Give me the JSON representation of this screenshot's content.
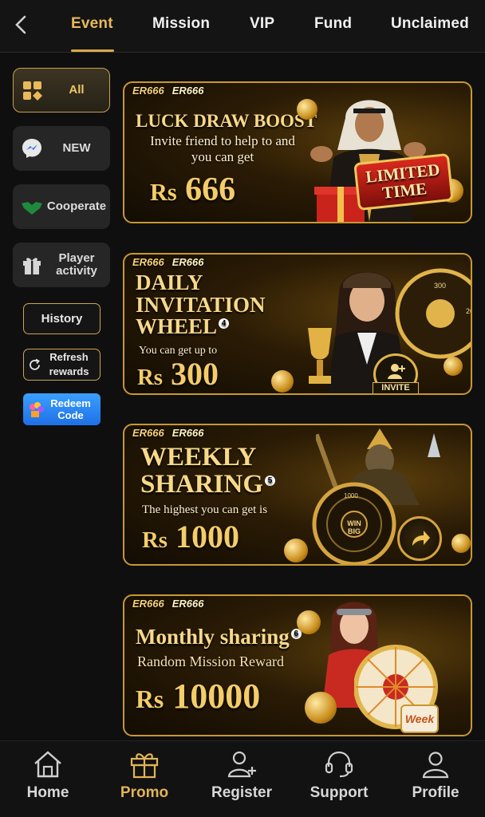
{
  "tabs": [
    {
      "label": "Event",
      "active": true
    },
    {
      "label": "Mission"
    },
    {
      "label": "VIP"
    },
    {
      "label": "Fund"
    },
    {
      "label": "Unclaimed"
    }
  ],
  "sidebar": {
    "items": [
      {
        "label": "All",
        "icon": "grid-icon",
        "active": true
      },
      {
        "label": "NEW",
        "icon": "messenger-icon"
      },
      {
        "label": "Cooperate",
        "icon": "handshake-icon"
      },
      {
        "label": "Player activity",
        "icon": "gift-icon"
      }
    ],
    "history": "History",
    "refresh": "Refresh rewards",
    "redeem": "Redeem Code"
  },
  "banners": [
    {
      "brand": "ER666",
      "title": "LUCK DRAW BOOST",
      "subtitle": "Invite friend to help to and you can get",
      "amount_prefix": "Rs",
      "amount": "666",
      "badge": "LIMITED TIME"
    },
    {
      "brand": "ER666",
      "title": "DAILY INVITATION WHEEL",
      "number": "4",
      "subtitle": "You can get up to",
      "amount_prefix": "Rs",
      "amount": "300",
      "badge": "INVITE"
    },
    {
      "brand": "ER666",
      "title": "WEEKLY SHARING",
      "number": "5",
      "subtitle": "The highest you can get is",
      "amount_prefix": "Rs",
      "amount": "1000",
      "badge": "WIN BIG"
    },
    {
      "brand": "ER666",
      "title": "Monthly sharing",
      "number": "6",
      "subtitle": "Random Mission Reward",
      "amount_prefix": "Rs",
      "amount": "10000",
      "badge": "Week"
    }
  ],
  "bottom_nav": [
    {
      "label": "Home",
      "icon": "home-icon"
    },
    {
      "label": "Promo",
      "icon": "gift-icon",
      "active": true
    },
    {
      "label": "Register",
      "icon": "add-user-icon"
    },
    {
      "label": "Support",
      "icon": "headset-icon"
    },
    {
      "label": "Profile",
      "icon": "user-icon"
    }
  ],
  "colors": {
    "accent": "#e3b457",
    "background": "#0f0f10",
    "banner_border": "#c9982f"
  }
}
